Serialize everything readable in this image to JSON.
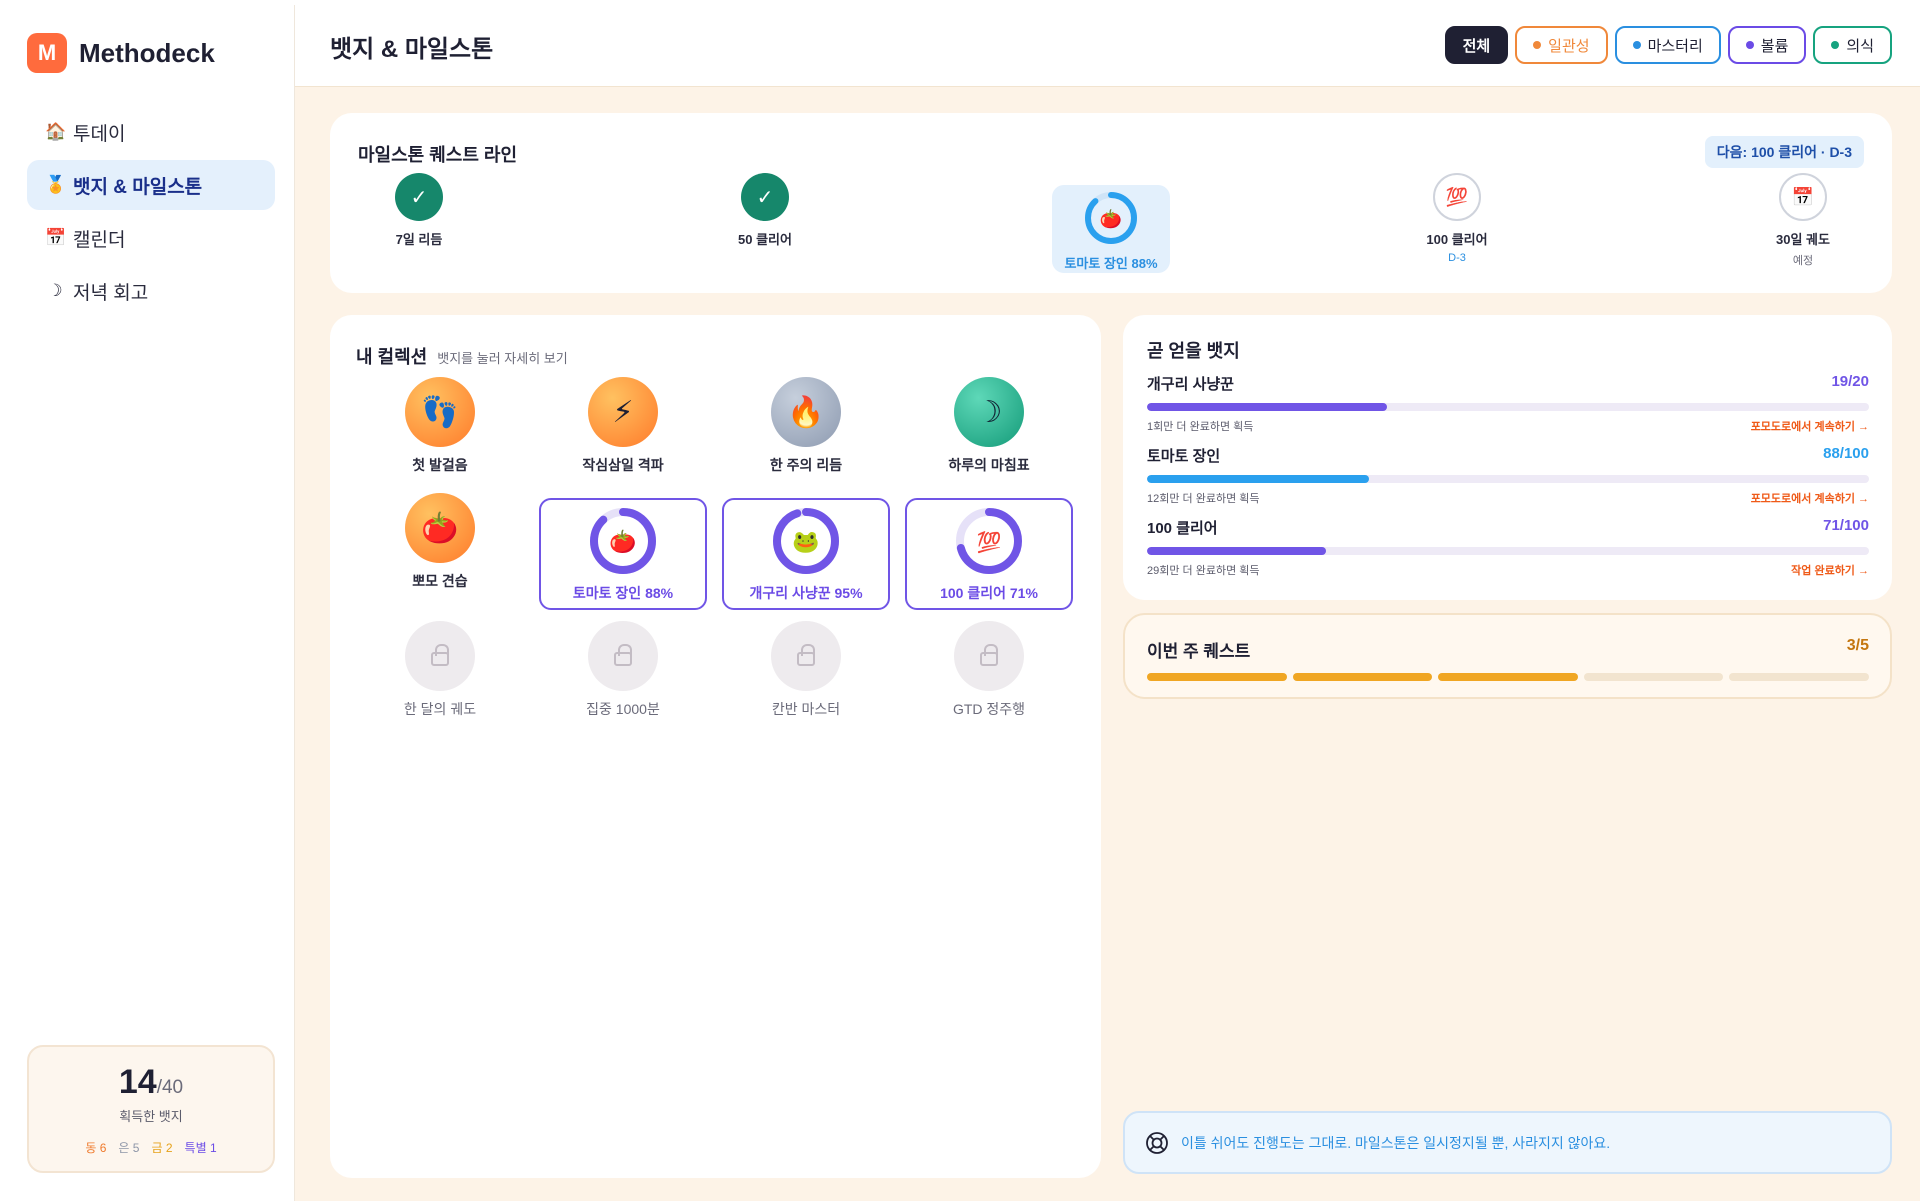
{
  "brand": {
    "logo_letter": "M",
    "name": "Methodeck"
  },
  "sidebar": {
    "items": [
      {
        "icon": "🏠",
        "label": "투데이"
      },
      {
        "icon": "🏅",
        "label": "뱃지 & 마일스톤"
      },
      {
        "icon": "📅",
        "label": "캘린더"
      },
      {
        "icon": "☽",
        "label": "저녁 회고"
      }
    ],
    "summary": {
      "count": "14",
      "total": "/40",
      "label": "획득한 뱃지",
      "tiers": {
        "bronze": "동 6",
        "silver": "은 5",
        "gold": "금 2",
        "special": "특별 1"
      }
    }
  },
  "header": {
    "title": "뱃지 & 마일스톤",
    "filters": [
      {
        "label": "전체",
        "color": "#1f2033"
      },
      {
        "label": "일관성",
        "color": "#f0883a"
      },
      {
        "label": "마스터리",
        "color": "#2a8fe0"
      },
      {
        "label": "볼륨",
        "color": "#6b4be6"
      },
      {
        "label": "의식",
        "color": "#16a37f"
      }
    ]
  },
  "quest_line": {
    "title": "마일스톤 퀘스트 라인",
    "next": "다음: 100 클리어 · D-3",
    "milestones": [
      {
        "label": "7일 리듬",
        "status": "done",
        "icon": "check-icon",
        "glyph": "✓"
      },
      {
        "label": "50 클리어",
        "status": "done",
        "icon": "check-icon",
        "glyph": "✓"
      },
      {
        "label": "토마토 장인 88%",
        "status": "in-progress",
        "progress": 0.88,
        "icon": "tomato-icon",
        "glyph": "🍅"
      },
      {
        "label": "100 클리어",
        "status": "upcoming",
        "sub": "D-3",
        "icon": "hundred-icon",
        "glyph": "💯"
      },
      {
        "label": "30일 궤도",
        "status": "upcoming",
        "sub": "예정",
        "icon": "calendar-icon",
        "glyph": "📅"
      }
    ]
  },
  "collection": {
    "title": "내 컬렉션",
    "subtitle": "뱃지를 눌러 자세히 보기",
    "earned": [
      {
        "label": "첫 발걸음",
        "glyph": "👣",
        "color": "orange"
      },
      {
        "label": "작심삼일 격파",
        "glyph": "⚡",
        "color": "orange"
      },
      {
        "label": "한 주의 리듬",
        "glyph": "🔥",
        "color": "slate"
      },
      {
        "label": "하루의 마침표",
        "glyph": "☽",
        "color": "teal"
      },
      {
        "label": "뽀모 견습",
        "glyph": "🍅",
        "color": "orange"
      }
    ],
    "in_progress": [
      {
        "label": "토마토 장인 88%",
        "progress": 0.88,
        "glyph": "🍅"
      },
      {
        "label": "개구리 사냥꾼 95%",
        "progress": 0.95,
        "glyph": "🐸"
      },
      {
        "label": "100 클리어 71%",
        "progress": 0.71,
        "glyph": "💯"
      }
    ],
    "locked": [
      {
        "label": "한 달의 궤도"
      },
      {
        "label": "집중 1000분"
      },
      {
        "label": "칸반 마스터"
      },
      {
        "label": "GTD 정주행"
      }
    ]
  },
  "upcoming": {
    "title": "곧 얻을 뱃지",
    "items": [
      {
        "name": "개구리 사냥꾼",
        "count": "19/20",
        "progress": 0.95,
        "color": "#7055e6",
        "hint": "1회만 더 완료하면 획득",
        "action": "포모도로에서 계속하기 →"
      },
      {
        "name": "토마토 장인",
        "count": "88/100",
        "progress": 0.88,
        "color": "#2aa0ee",
        "hint": "12회만 더 완료하면 획득",
        "action": "포모도로에서 계속하기 →"
      },
      {
        "name": "100 클리어",
        "count": "71/100",
        "progress": 0.71,
        "color": "#7055e6",
        "hint": "29회만 더 완료하면 획득",
        "action": "작업 완료하기 →"
      }
    ]
  },
  "weekly": {
    "title": "이번 주 퀘스트",
    "count": "3/5",
    "done": 3,
    "total": 5
  },
  "note": {
    "text": "이틀 쉬어도 진행도는 그대로. 마일스톤은 일시정지될 뿐, 사라지지 않아요."
  }
}
